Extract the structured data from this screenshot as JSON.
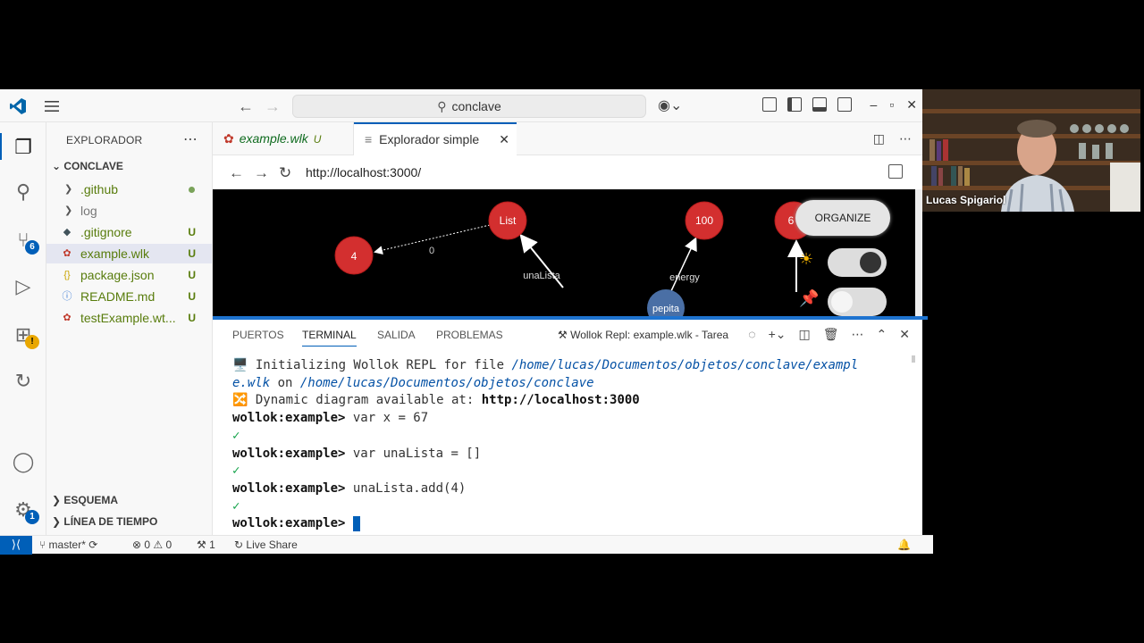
{
  "titlebar": {
    "search_text": "conclave"
  },
  "sidebar": {
    "header": "EXPLORADOR",
    "folder": "CONCLAVE",
    "items": [
      {
        "name": ".github",
        "mark": ""
      },
      {
        "name": "log",
        "mark": ""
      },
      {
        "name": ".gitignore",
        "mark": "U"
      },
      {
        "name": "example.wlk",
        "mark": "U"
      },
      {
        "name": "package.json",
        "mark": "U"
      },
      {
        "name": "README.md",
        "mark": "U"
      },
      {
        "name": "testExample.wt...",
        "mark": "U"
      }
    ],
    "sections": [
      "ESQUEMA",
      "LÍNEA DE TIEMPO"
    ]
  },
  "activity": {
    "scm_badge": "6",
    "settings_badge": "1"
  },
  "tabs": [
    {
      "label": "example.wlk",
      "mark": "U"
    },
    {
      "label": "Explorador simple"
    }
  ],
  "browser": {
    "url": "http://localhost:3000/"
  },
  "diagram": {
    "nodes": [
      {
        "label": "4"
      },
      {
        "label": "List"
      },
      {
        "label": "100"
      },
      {
        "label": "6"
      },
      {
        "label": "pepita"
      }
    ],
    "edges": [
      {
        "label": "0"
      },
      {
        "label": "unaLista"
      },
      {
        "label": "energy"
      }
    ],
    "organize_label": "ORGANIZE",
    "colors": {
      "node": "#d32f2f",
      "object": "#4a6fa5"
    }
  },
  "panel": {
    "tabs": [
      "PUERTOS",
      "TERMINAL",
      "SALIDA",
      "PROBLEMAS"
    ],
    "task": "Wollok Repl: example.wlk - Tarea"
  },
  "terminal": {
    "init_prefix": "🖥️ Initializing Wollok REPL for file ",
    "init_path1": "/home/lucas/Documentos/objetos/conclave/exampl",
    "init_path1b": "e.wlk",
    "init_on": " on ",
    "init_path2": "/home/lucas/Documentos/objetos/conclave",
    "diagram_prefix": "🔀 Dynamic diagram available at: ",
    "diagram_url": "http://localhost:3000",
    "prompt": "wollok:example>",
    "cmd1": " var x = 67",
    "cmd2": " var unaLista = []",
    "cmd3": " unaLista.add(4)",
    "ok": "✓"
  },
  "status": {
    "branch": "master*",
    "errors": "0",
    "warnings": "0",
    "ports": "1",
    "liveshare": "Live Share"
  },
  "webcam": {
    "name": "Lucas Spigariol"
  }
}
